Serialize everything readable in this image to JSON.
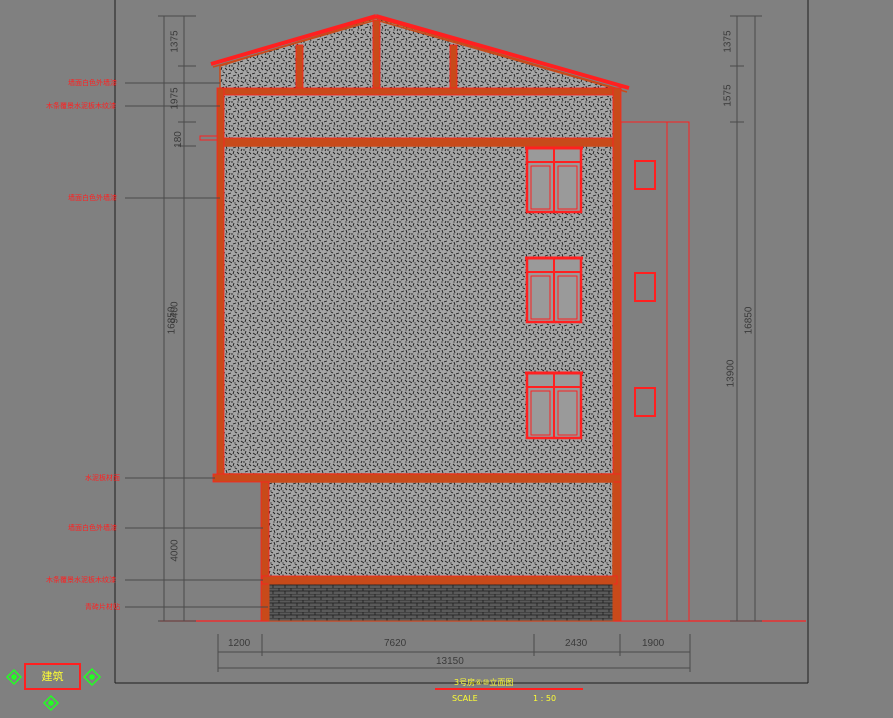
{
  "annotations": [
    "墙面白色外墙漆",
    "木条覆景水泥板木纹漆",
    "墙面白色外墙漆",
    "水泥板材面",
    "墙面白色外墙漆",
    "木条覆景水泥板木纹漆",
    "青砖片材贴"
  ],
  "left_dims": [
    "1375",
    "1975",
    "180",
    "9400",
    "4000"
  ],
  "left_total": "16850",
  "right_dims": [
    "1375",
    "1575",
    "13900"
  ],
  "right_total": "16850",
  "bottom_dims": [
    "1200",
    "7620",
    "2430",
    "1900"
  ],
  "bottom_total": "13150",
  "ucs_label": "建筑",
  "drawing_title": "3号房⑥⑩立面图",
  "scale_label": "SCALE",
  "scale_value": "1 : 50",
  "colors": {
    "background": "#808080",
    "outline": "#ff2020",
    "frame": "#c84a1a",
    "dim": "#4a4a4a",
    "title": "#ffff33",
    "ucs": "#22ff22"
  }
}
